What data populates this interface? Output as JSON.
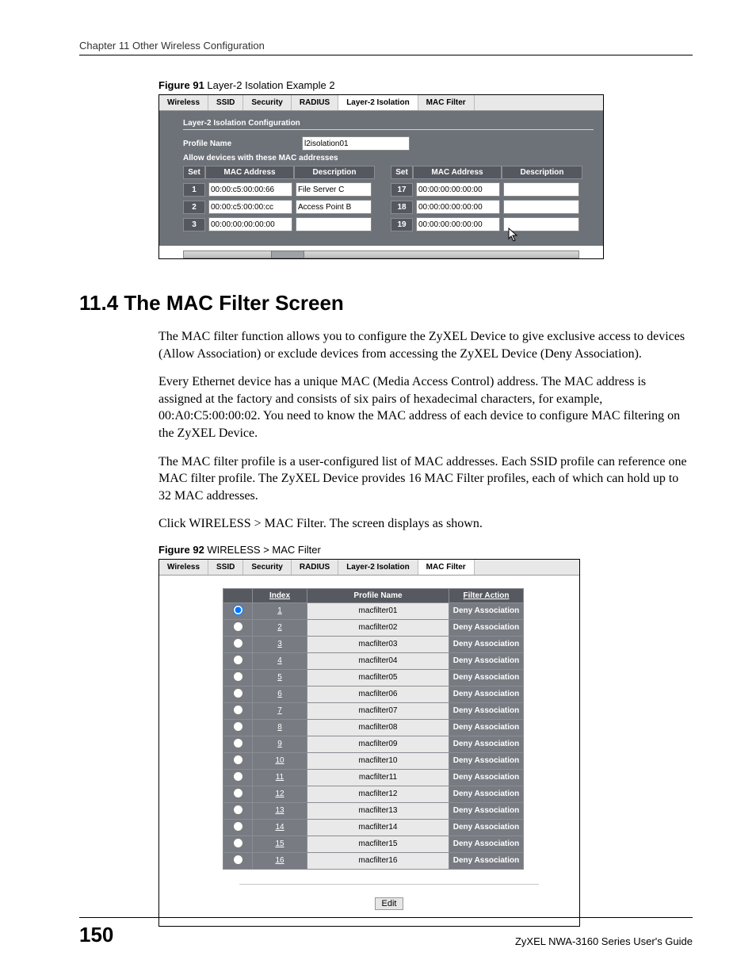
{
  "runningHeader": "Chapter 11 Other Wireless Configuration",
  "fig91": {
    "captionBold": "Figure 91",
    "captionText": "   Layer-2 Isolation Example 2",
    "tabs": [
      "Wireless",
      "SSID",
      "Security",
      "RADIUS",
      "Layer-2 Isolation",
      "MAC Filter"
    ],
    "activeTab": 4,
    "sectionTitle": "Layer-2 Isolation Configuration",
    "profileLabel": "Profile Name",
    "profileValue": "l2isolation01",
    "allowLabel": "Allow devices with these MAC addresses",
    "headers": {
      "set": "Set",
      "mac": "MAC Address",
      "desc": "Description"
    },
    "left": [
      {
        "set": "1",
        "mac": "00:00:c5:00:00:66",
        "desc": "File Server C"
      },
      {
        "set": "2",
        "mac": "00:00:c5:00:00:cc",
        "desc": "Access Point B"
      },
      {
        "set": "3",
        "mac": "00:00:00:00:00:00",
        "desc": ""
      }
    ],
    "right": [
      {
        "set": "17",
        "mac": "00:00:00:00:00:00",
        "desc": ""
      },
      {
        "set": "18",
        "mac": "00:00:00:00:00:00",
        "desc": ""
      },
      {
        "set": "19",
        "mac": "00:00:00:00:00:00",
        "desc": ""
      }
    ]
  },
  "section": {
    "heading": "11.4  The MAC Filter Screen",
    "p1": "The MAC filter function allows you to configure the ZyXEL Device to give exclusive access to devices (Allow Association) or exclude devices from accessing the ZyXEL Device (Deny Association).",
    "p2": "Every Ethernet device has a unique MAC (Media Access Control) address. The MAC address is assigned at the factory and consists of six pairs of hexadecimal characters, for example, 00:A0:C5:00:00:02. You need to know the MAC address of each device to configure MAC filtering on the ZyXEL Device.",
    "p3": "The MAC filter profile is a user-configured list of MAC addresses. Each SSID profile can reference one MAC filter profile. The ZyXEL Device provides 16 MAC Filter profiles, each of which can hold up to 32 MAC addresses.",
    "p4": "Click WIRELESS > MAC Filter. The screen displays as shown."
  },
  "fig92": {
    "captionBold": "Figure 92",
    "captionText": "   WIRELESS > MAC Filter",
    "tabs": [
      "Wireless",
      "SSID",
      "Security",
      "RADIUS",
      "Layer-2 Isolation",
      "MAC Filter"
    ],
    "activeTab": 5,
    "headers": {
      "blank": "",
      "index": "Index",
      "profile": "Profile Name",
      "action": "Filter Action"
    },
    "rows": [
      {
        "i": "1",
        "p": "macfilter01",
        "a": "Deny Association",
        "sel": true
      },
      {
        "i": "2",
        "p": "macfilter02",
        "a": "Deny Association",
        "sel": false
      },
      {
        "i": "3",
        "p": "macfilter03",
        "a": "Deny Association",
        "sel": false
      },
      {
        "i": "4",
        "p": "macfilter04",
        "a": "Deny Association",
        "sel": false
      },
      {
        "i": "5",
        "p": "macfilter05",
        "a": "Deny Association",
        "sel": false
      },
      {
        "i": "6",
        "p": "macfilter06",
        "a": "Deny Association",
        "sel": false
      },
      {
        "i": "7",
        "p": "macfilter07",
        "a": "Deny Association",
        "sel": false
      },
      {
        "i": "8",
        "p": "macfilter08",
        "a": "Deny Association",
        "sel": false
      },
      {
        "i": "9",
        "p": "macfilter09",
        "a": "Deny Association",
        "sel": false
      },
      {
        "i": "10",
        "p": "macfilter10",
        "a": "Deny Association",
        "sel": false
      },
      {
        "i": "11",
        "p": "macfilter11",
        "a": "Deny Association",
        "sel": false
      },
      {
        "i": "12",
        "p": "macfilter12",
        "a": "Deny Association",
        "sel": false
      },
      {
        "i": "13",
        "p": "macfilter13",
        "a": "Deny Association",
        "sel": false
      },
      {
        "i": "14",
        "p": "macfilter14",
        "a": "Deny Association",
        "sel": false
      },
      {
        "i": "15",
        "p": "macfilter15",
        "a": "Deny Association",
        "sel": false
      },
      {
        "i": "16",
        "p": "macfilter16",
        "a": "Deny Association",
        "sel": false
      }
    ],
    "editLabel": "Edit"
  },
  "footer": {
    "page": "150",
    "guide": "ZyXEL NWA-3160 Series User's Guide"
  }
}
